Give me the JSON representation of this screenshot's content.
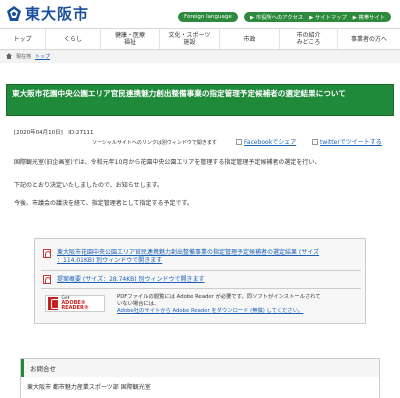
{
  "header": {
    "logo_text": "東大阪市",
    "lang_button": "Foreign language",
    "links": [
      "市役所へのアクセス",
      "サイトマップ",
      "携帯サイト"
    ]
  },
  "nav": {
    "items": [
      {
        "label": "トップ"
      },
      {
        "label": "くらし"
      },
      {
        "label": "健康・医療\n福祉"
      },
      {
        "label": "文化・スポーツ\n施設"
      },
      {
        "label": "市政"
      },
      {
        "label": "市の紹介\nみどころ"
      },
      {
        "label": "事業者の方へ"
      }
    ]
  },
  "breadcrumb": {
    "home": "現在地",
    "current": "トップ"
  },
  "article": {
    "title": "東大阪市花園中央公園エリア官民連携魅力創出整備事業の指定管理予定候補者の選定結果について",
    "meta": "[2020年04月10日]　ID:27111",
    "social_note": "ソーシャルサイトへのリンクは別ウィンドウで開きます",
    "share_facebook": "Facebookでシェア",
    "share_twitter": "twitterでツイートする",
    "paragraphs": [
      "国際観光室(旧企画室)では、令和元年10月から花園中央公園エリアを管理する指定管理予定候補者の選定を行い、",
      "下記のとおり決定いたしましたので、お知らせします。",
      "今後、市議会の議決を経て、指定管理者として指定する予定です。"
    ]
  },
  "files": {
    "file1_line1": "東大阪市花園中央公園エリア官民連携魅力創出整備事業の指定管理予定候補者の選定結果 (サイズ",
    "file1_line2": "：114.01KB) 別ウィンドウで開きます",
    "file2": "提案概要 (サイズ：28.74KB) 別ウィンドウで開きます",
    "adobe_small": "Get",
    "adobe_brand": "ADOBE® READER®",
    "pdf_note1": "PDFファイルの閲覧には Adobe Reader が必要です。同ソフトがインストールされて",
    "pdf_note2": "いない場合には、",
    "pdf_note3": "Adobe社のサイトから Adobe Reader をダウンロード (無償) してください。"
  },
  "contact": {
    "heading": "お問合せ",
    "dept": "東大阪市 都市魅力産業スポーツ部 国際観光室"
  },
  "colors": {
    "brand_green": "#1f8a3a",
    "logo_blue": "#1a4f9c",
    "link_blue": "#1a5fb4"
  }
}
